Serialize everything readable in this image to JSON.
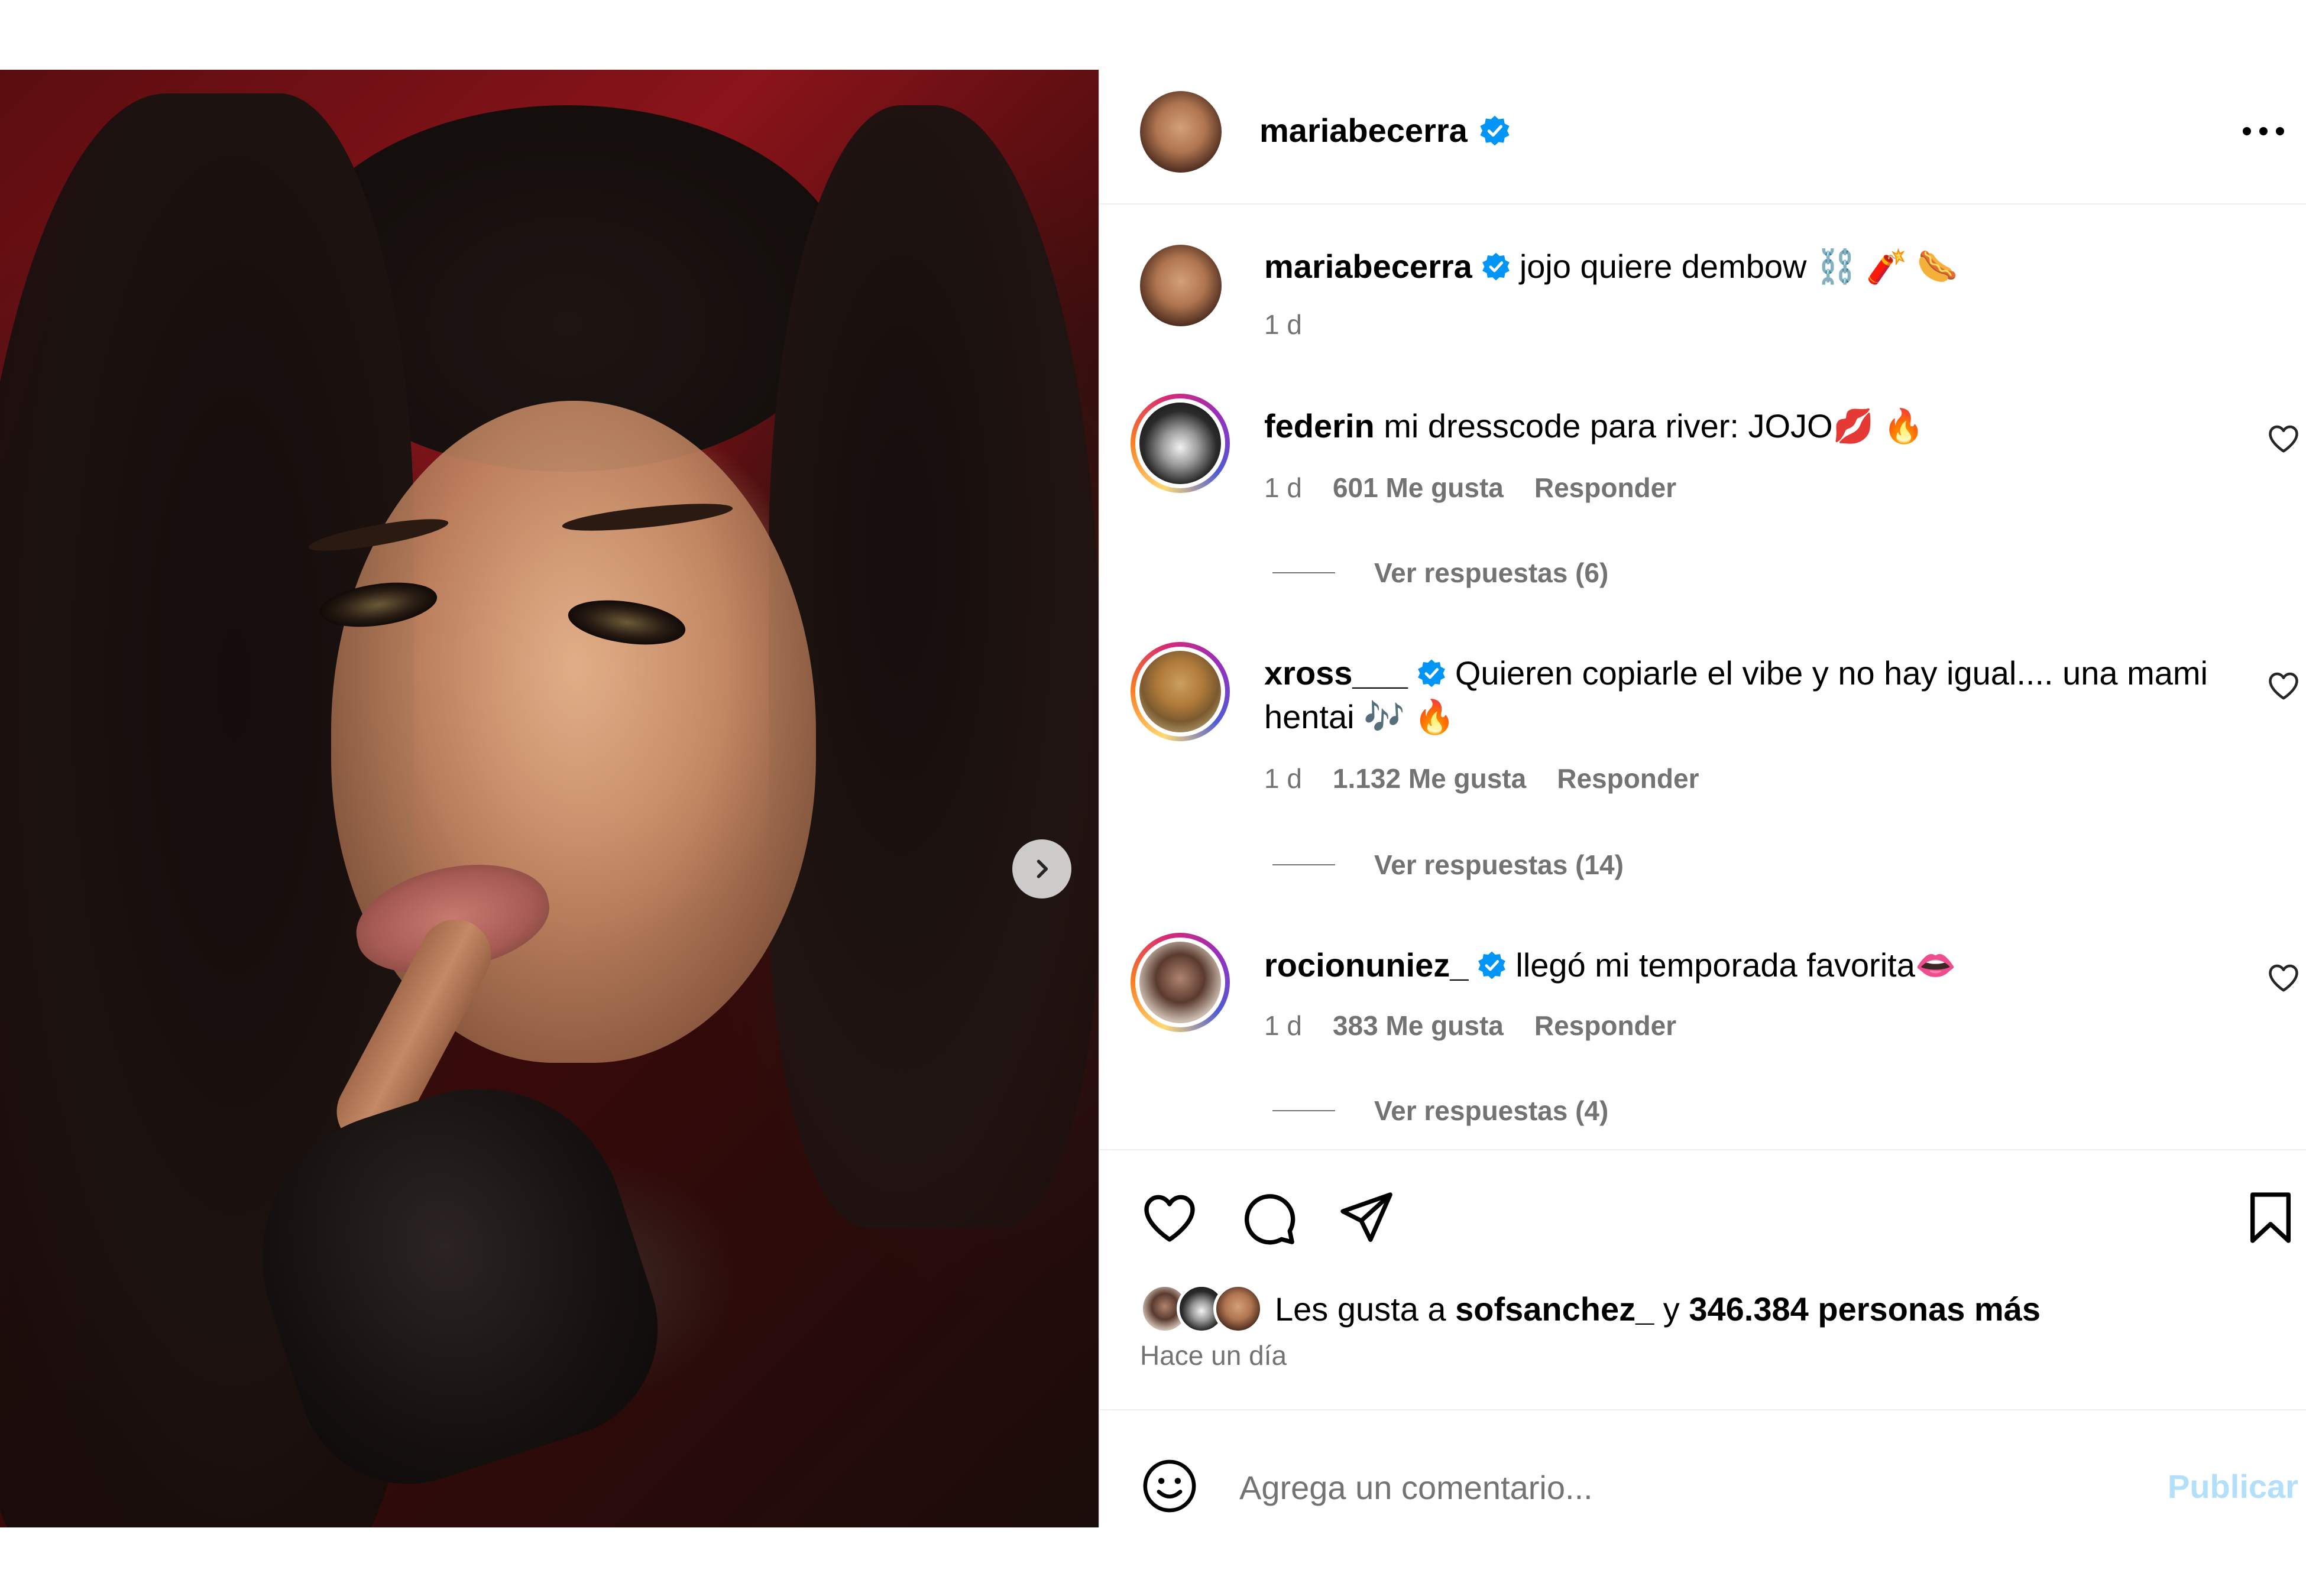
{
  "post": {
    "author": "mariabecerra",
    "more_icon": "more-horizontal-icon",
    "caption": "jojo quiere dembow ⛓️ 🧨 🌭",
    "caption_time": "1 d"
  },
  "comments": [
    {
      "username": "federin",
      "text": "mi dresscode para river: JOJO💋 🔥",
      "time": "1 d",
      "likes": "601 Me gusta",
      "reply": "Responder",
      "view_replies": "Ver respuestas (6)"
    },
    {
      "username": "xross___",
      "text_line1": "Quieren copiarle el vibe y no hay igual.... una mami",
      "text_line2": "hentai 🎶 🔥",
      "time": "1 d",
      "likes": "1.132 Me gusta",
      "reply": "Responder",
      "view_replies": "Ver respuestas (14)"
    },
    {
      "username": "rocionuniez_",
      "text": "llegó mi temporada favorita👄",
      "time": "1 d",
      "likes": "383 Me gusta",
      "reply": "Responder",
      "view_replies": "Ver respuestas (4)"
    }
  ],
  "likes": {
    "prefix": "Les gusta a ",
    "user": "sofsanchez_",
    "connector": " y ",
    "others": "346.384 personas más"
  },
  "time_ago": "Hace un día",
  "comment_box": {
    "placeholder": "Agrega un comentario...",
    "publish_label": "Publicar"
  },
  "colors": {
    "verified": "#0095f6",
    "secondary_text": "#737373",
    "publish_disabled": "#b2dffc"
  },
  "carousel": {
    "slides": 4,
    "active": 1
  }
}
